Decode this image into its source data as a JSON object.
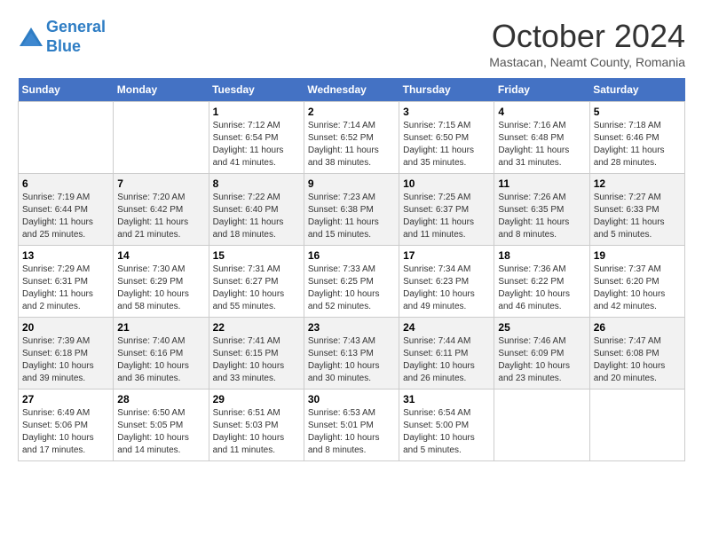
{
  "header": {
    "logo_line1": "General",
    "logo_line2": "Blue",
    "month_title": "October 2024",
    "subtitle": "Mastacan, Neamt County, Romania"
  },
  "days_of_week": [
    "Sunday",
    "Monday",
    "Tuesday",
    "Wednesday",
    "Thursday",
    "Friday",
    "Saturday"
  ],
  "weeks": [
    [
      {
        "day": "",
        "sunrise": "",
        "sunset": "",
        "daylight": ""
      },
      {
        "day": "",
        "sunrise": "",
        "sunset": "",
        "daylight": ""
      },
      {
        "day": "1",
        "sunrise": "Sunrise: 7:12 AM",
        "sunset": "Sunset: 6:54 PM",
        "daylight": "Daylight: 11 hours and 41 minutes."
      },
      {
        "day": "2",
        "sunrise": "Sunrise: 7:14 AM",
        "sunset": "Sunset: 6:52 PM",
        "daylight": "Daylight: 11 hours and 38 minutes."
      },
      {
        "day": "3",
        "sunrise": "Sunrise: 7:15 AM",
        "sunset": "Sunset: 6:50 PM",
        "daylight": "Daylight: 11 hours and 35 minutes."
      },
      {
        "day": "4",
        "sunrise": "Sunrise: 7:16 AM",
        "sunset": "Sunset: 6:48 PM",
        "daylight": "Daylight: 11 hours and 31 minutes."
      },
      {
        "day": "5",
        "sunrise": "Sunrise: 7:18 AM",
        "sunset": "Sunset: 6:46 PM",
        "daylight": "Daylight: 11 hours and 28 minutes."
      }
    ],
    [
      {
        "day": "6",
        "sunrise": "Sunrise: 7:19 AM",
        "sunset": "Sunset: 6:44 PM",
        "daylight": "Daylight: 11 hours and 25 minutes."
      },
      {
        "day": "7",
        "sunrise": "Sunrise: 7:20 AM",
        "sunset": "Sunset: 6:42 PM",
        "daylight": "Daylight: 11 hours and 21 minutes."
      },
      {
        "day": "8",
        "sunrise": "Sunrise: 7:22 AM",
        "sunset": "Sunset: 6:40 PM",
        "daylight": "Daylight: 11 hours and 18 minutes."
      },
      {
        "day": "9",
        "sunrise": "Sunrise: 7:23 AM",
        "sunset": "Sunset: 6:38 PM",
        "daylight": "Daylight: 11 hours and 15 minutes."
      },
      {
        "day": "10",
        "sunrise": "Sunrise: 7:25 AM",
        "sunset": "Sunset: 6:37 PM",
        "daylight": "Daylight: 11 hours and 11 minutes."
      },
      {
        "day": "11",
        "sunrise": "Sunrise: 7:26 AM",
        "sunset": "Sunset: 6:35 PM",
        "daylight": "Daylight: 11 hours and 8 minutes."
      },
      {
        "day": "12",
        "sunrise": "Sunrise: 7:27 AM",
        "sunset": "Sunset: 6:33 PM",
        "daylight": "Daylight: 11 hours and 5 minutes."
      }
    ],
    [
      {
        "day": "13",
        "sunrise": "Sunrise: 7:29 AM",
        "sunset": "Sunset: 6:31 PM",
        "daylight": "Daylight: 11 hours and 2 minutes."
      },
      {
        "day": "14",
        "sunrise": "Sunrise: 7:30 AM",
        "sunset": "Sunset: 6:29 PM",
        "daylight": "Daylight: 10 hours and 58 minutes."
      },
      {
        "day": "15",
        "sunrise": "Sunrise: 7:31 AM",
        "sunset": "Sunset: 6:27 PM",
        "daylight": "Daylight: 10 hours and 55 minutes."
      },
      {
        "day": "16",
        "sunrise": "Sunrise: 7:33 AM",
        "sunset": "Sunset: 6:25 PM",
        "daylight": "Daylight: 10 hours and 52 minutes."
      },
      {
        "day": "17",
        "sunrise": "Sunrise: 7:34 AM",
        "sunset": "Sunset: 6:23 PM",
        "daylight": "Daylight: 10 hours and 49 minutes."
      },
      {
        "day": "18",
        "sunrise": "Sunrise: 7:36 AM",
        "sunset": "Sunset: 6:22 PM",
        "daylight": "Daylight: 10 hours and 46 minutes."
      },
      {
        "day": "19",
        "sunrise": "Sunrise: 7:37 AM",
        "sunset": "Sunset: 6:20 PM",
        "daylight": "Daylight: 10 hours and 42 minutes."
      }
    ],
    [
      {
        "day": "20",
        "sunrise": "Sunrise: 7:39 AM",
        "sunset": "Sunset: 6:18 PM",
        "daylight": "Daylight: 10 hours and 39 minutes."
      },
      {
        "day": "21",
        "sunrise": "Sunrise: 7:40 AM",
        "sunset": "Sunset: 6:16 PM",
        "daylight": "Daylight: 10 hours and 36 minutes."
      },
      {
        "day": "22",
        "sunrise": "Sunrise: 7:41 AM",
        "sunset": "Sunset: 6:15 PM",
        "daylight": "Daylight: 10 hours and 33 minutes."
      },
      {
        "day": "23",
        "sunrise": "Sunrise: 7:43 AM",
        "sunset": "Sunset: 6:13 PM",
        "daylight": "Daylight: 10 hours and 30 minutes."
      },
      {
        "day": "24",
        "sunrise": "Sunrise: 7:44 AM",
        "sunset": "Sunset: 6:11 PM",
        "daylight": "Daylight: 10 hours and 26 minutes."
      },
      {
        "day": "25",
        "sunrise": "Sunrise: 7:46 AM",
        "sunset": "Sunset: 6:09 PM",
        "daylight": "Daylight: 10 hours and 23 minutes."
      },
      {
        "day": "26",
        "sunrise": "Sunrise: 7:47 AM",
        "sunset": "Sunset: 6:08 PM",
        "daylight": "Daylight: 10 hours and 20 minutes."
      }
    ],
    [
      {
        "day": "27",
        "sunrise": "Sunrise: 6:49 AM",
        "sunset": "Sunset: 5:06 PM",
        "daylight": "Daylight: 10 hours and 17 minutes."
      },
      {
        "day": "28",
        "sunrise": "Sunrise: 6:50 AM",
        "sunset": "Sunset: 5:05 PM",
        "daylight": "Daylight: 10 hours and 14 minutes."
      },
      {
        "day": "29",
        "sunrise": "Sunrise: 6:51 AM",
        "sunset": "Sunset: 5:03 PM",
        "daylight": "Daylight: 10 hours and 11 minutes."
      },
      {
        "day": "30",
        "sunrise": "Sunrise: 6:53 AM",
        "sunset": "Sunset: 5:01 PM",
        "daylight": "Daylight: 10 hours and 8 minutes."
      },
      {
        "day": "31",
        "sunrise": "Sunrise: 6:54 AM",
        "sunset": "Sunset: 5:00 PM",
        "daylight": "Daylight: 10 hours and 5 minutes."
      },
      {
        "day": "",
        "sunrise": "",
        "sunset": "",
        "daylight": ""
      },
      {
        "day": "",
        "sunrise": "",
        "sunset": "",
        "daylight": ""
      }
    ]
  ]
}
